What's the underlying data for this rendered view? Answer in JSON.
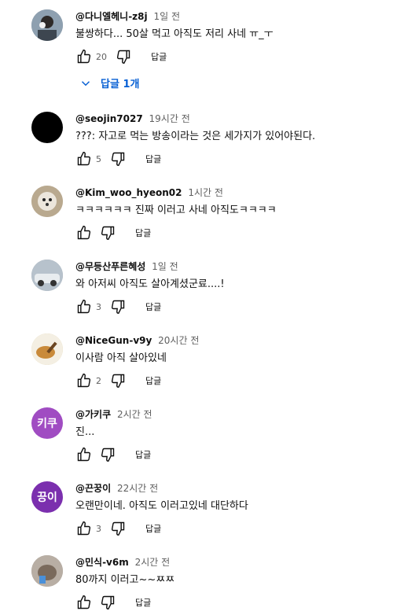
{
  "comments": [
    {
      "handle": "@다니엘헤니-z8j",
      "time": "1일 전",
      "text": "불쌍하다... 50살 먹고 아직도 저리 사네 ㅠ_ㅜ",
      "likes": "20",
      "reply": "답글",
      "avatar_color": "#5a6b7a"
    },
    {
      "handle": "@seojin7027",
      "time": "19시간 전",
      "text": "???: 자고로 먹는 방송이라는 것은 세가지가 있어야된다.",
      "likes": "5",
      "reply": "답글",
      "avatar_color": "#000000"
    },
    {
      "handle": "@Kim_woo_hyeon02",
      "time": "1시간 전",
      "text": "ㅋㅋㅋㅋㅋㅋ 진짜 이러고 사네 아직도ㅋㅋㅋㅋ",
      "likes": "",
      "reply": "답글",
      "avatar_color": "#c9bfb0"
    },
    {
      "handle": "@무등산푸른혜성",
      "time": "1일 전",
      "text": "와 아저씨 아직도 살아계셨군료....!",
      "likes": "3",
      "reply": "답글",
      "avatar_color": "#8a95a0"
    },
    {
      "handle": "@NiceGun-v9y",
      "time": "20시간 전",
      "text": "이사람 아직 살아있네",
      "likes": "2",
      "reply": "답글",
      "avatar_color": "#d9c48a"
    },
    {
      "handle": "@가키쿠",
      "time": "2시간 전",
      "text": "진...",
      "likes": "",
      "reply": "답글",
      "avatar_text": "키쿠",
      "avatar_color": "#a04cc2"
    },
    {
      "handle": "@끈꿍이",
      "time": "22시간 전",
      "text": "오랜만이네. 아직도 이러고있네 대단하다",
      "likes": "3",
      "reply": "답글",
      "avatar_text": "끙이",
      "avatar_color": "#7b2fae"
    },
    {
      "handle": "@민식-v6m",
      "time": "2시간 전",
      "text": "80까지 이러고~~ㅉㅉ",
      "likes": "",
      "reply": "답글",
      "avatar_color": "#9a8f86"
    }
  ],
  "replies_toggle": {
    "label": "답글 1개"
  },
  "colors": {
    "link": "#065fd4",
    "secondary": "#606060"
  }
}
